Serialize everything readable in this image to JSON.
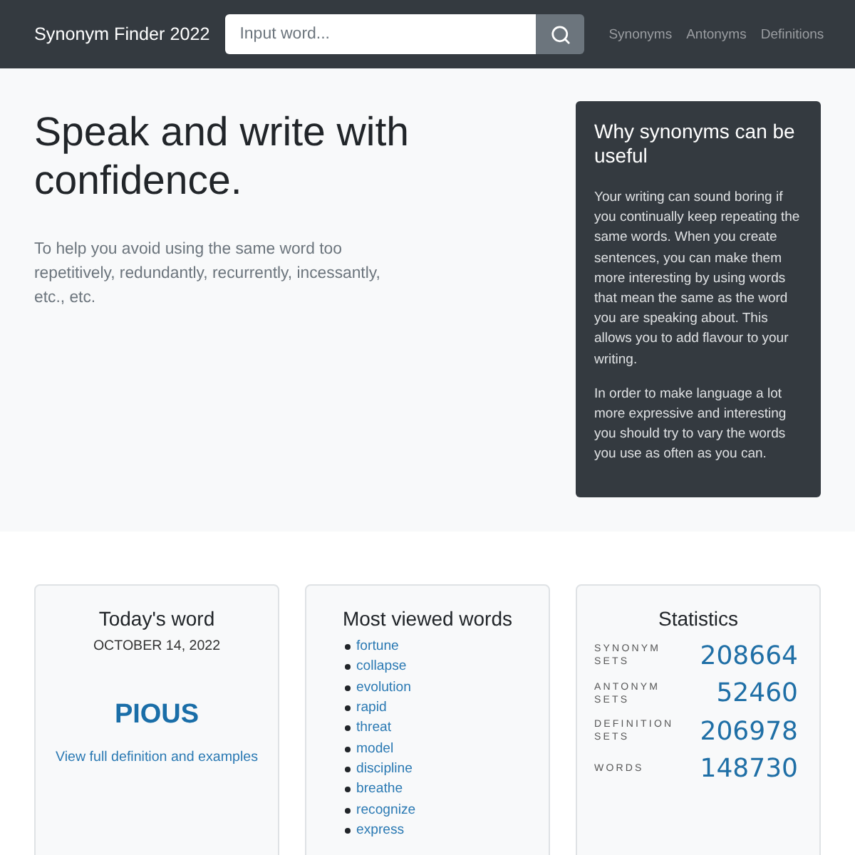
{
  "navbar": {
    "brand": "Synonym Finder 2022",
    "search": {
      "placeholder": "Input word..."
    },
    "links": [
      "Synonyms",
      "Antonyms",
      "Definitions"
    ]
  },
  "hero": {
    "heading": "Speak and write with confidence.",
    "lead": "To help you avoid using the same word too repetitively, redundantly, recurrently, incessantly, etc., etc.",
    "aside": {
      "title": "Why synonyms can be useful",
      "paragraphs": [
        "Your writing can sound boring if you continually keep repeating the same words. When you create sentences, you can make them more interesting by using words that mean the same as the word you are speaking about. This allows you to add flavour to your writing.",
        "In order to make language a lot more expressive and interesting you should try to vary the words you use as often as you can."
      ]
    }
  },
  "todays_word": {
    "title": "Today's word",
    "date": "OCTOBER 14, 2022",
    "word": "PIOUS",
    "link": "View full definition and examples"
  },
  "most_viewed": {
    "title": "Most viewed words",
    "words": [
      "fortune",
      "collapse",
      "evolution",
      "rapid",
      "threat",
      "model",
      "discipline",
      "breathe",
      "recognize",
      "express"
    ]
  },
  "statistics": {
    "title": "Statistics",
    "rows": [
      {
        "label": "SYNONYM SETS",
        "value": "208664"
      },
      {
        "label": "ANTONYM SETS",
        "value": "52460"
      },
      {
        "label": "DEFINITION SETS",
        "value": "206978"
      },
      {
        "label": "WORDS",
        "value": "148730"
      }
    ]
  }
}
